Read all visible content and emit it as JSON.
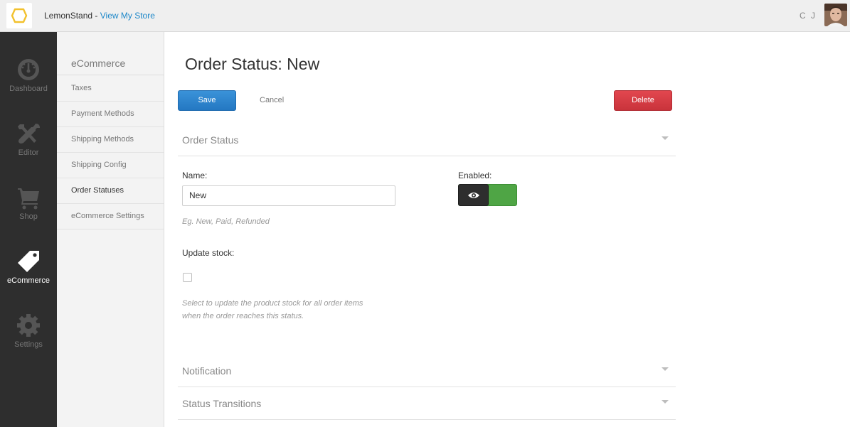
{
  "topbar": {
    "brand_name": "LemonStand",
    "separator": " - ",
    "view_store_link": "View My Store",
    "user_initials": "C J",
    "accent": "#1e88c9"
  },
  "leftnav": {
    "items": [
      {
        "label": "Dashboard",
        "icon": "dashboard-gauge-icon"
      },
      {
        "label": "Editor",
        "icon": "tools-icon"
      },
      {
        "label": "Shop",
        "icon": "cart-icon"
      },
      {
        "label": "eCommerce",
        "icon": "tag-icon",
        "active": true
      },
      {
        "label": "Settings",
        "icon": "gear-icon"
      }
    ]
  },
  "subnav": {
    "title": "eCommerce",
    "items": [
      {
        "label": "Taxes"
      },
      {
        "label": "Payment Methods"
      },
      {
        "label": "Shipping Methods"
      },
      {
        "label": "Shipping Config"
      },
      {
        "label": "Order Statuses",
        "active": true
      },
      {
        "label": "eCommerce Settings"
      }
    ]
  },
  "main": {
    "title": "Order Status: New",
    "save_label": "Save",
    "cancel_label": "Cancel",
    "delete_label": "Delete",
    "sections": {
      "order_status": "Order Status",
      "notification": "Notification",
      "status_transitions": "Status Transitions"
    },
    "name_label": "Name:",
    "name_value": "New",
    "name_hint": "Eg. New, Paid, Refunded",
    "enabled_label": "Enabled:",
    "enabled": true,
    "update_stock_label": "Update stock:",
    "update_stock_checked": false,
    "update_stock_hint_line1": "Select to update the product stock for all order items",
    "update_stock_hint_line2": "when the order reaches this status.",
    "save_color": "#2a82cc",
    "delete_color": "#d63c44",
    "toggle_color": "#4fa545"
  }
}
